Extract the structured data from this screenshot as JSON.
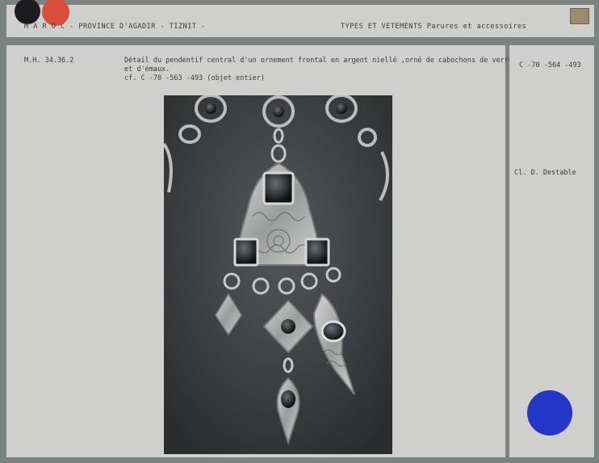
{
  "header": {
    "left": "M A R O C  - PROVINCE D'AGADIR  -   TIZNIT  -",
    "right": "TYPES ET VETEMENTS  Parures et accessoires"
  },
  "record": {
    "reference": "M.H. 34.36.2",
    "description_line1": "Détail du pendentif central d'un ornement frontal en argent  niellé ,orné de cabochons de verre",
    "description_line2": "et d'émaux.",
    "description_line3": "cf. C -70 -563 -493  (objet entier)"
  },
  "side": {
    "code": "C -70 -564 -493",
    "credit": "Cl. D. Destable"
  },
  "colors": {
    "card": "#cfcfcd",
    "frame": "#7a837f",
    "dot_red": "#d94d3b",
    "dot_black": "#1c1c1e",
    "dot_blue": "#2436c8"
  },
  "photo": {
    "subject": "silver pendant with glass cabochons"
  }
}
